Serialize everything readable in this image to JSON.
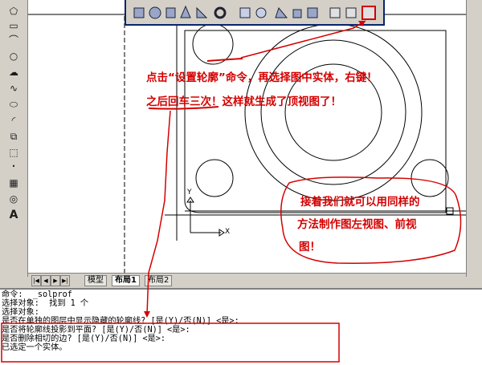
{
  "toolbar_icons": [
    "box-icon",
    "sphere-icon",
    "cylinder-icon",
    "cone-icon",
    "wedge-icon",
    "torus-icon",
    "extrude-icon",
    "revolve-icon",
    "slice-icon",
    "section-icon",
    "interfere-icon",
    "setup-drawing-icon",
    "setup-view-icon",
    "setup-profile-icon"
  ],
  "left_tools": [
    "polygon-icon",
    "rectangle-icon",
    "arc-icon",
    "circle-icon",
    "revision-cloud-icon",
    "spline-icon",
    "ellipse-icon",
    "ellipse-arc-icon",
    "insert-block-icon",
    "make-block-icon",
    "point-icon",
    "hatch-icon",
    "region-icon",
    "text-icon"
  ],
  "glyphs": {
    "polygon": "⬠",
    "rectangle": "▭",
    "arc": "⌒",
    "circle": "○",
    "cloud": "☁",
    "spline": "∿",
    "ellipse": "⬭",
    "ellarc": "◜",
    "insert": "⧉",
    "block": "⬚",
    "point": "·",
    "hatch": "▦",
    "region": "◎",
    "text": "A"
  },
  "tabs": {
    "model": "模型",
    "layout1": "布局1",
    "layout2": "布局2"
  },
  "annotations": {
    "line1": "点击“设置轮廓”命令，再选择图中实体，右键！",
    "line2": "之后回车三次！这样就生成了顶视图了！",
    "box_line1": "接着我们就可以用同样的",
    "box_line2": "方法制作图左视图、前视",
    "box_line3": "图！"
  },
  "axis": {
    "y": "Y",
    "x": "X"
  },
  "command_lines": [
    "命令:  _solprof",
    "选择对象:  找到 1 个",
    "选择对象:",
    "是否在单独的图层中显示隐藏的轮廓线? [是(Y)/否(N)] <是>:",
    "是否将轮廓线投影到平面? [是(Y)/否(N)] <是>:",
    "是否删除相切的边? [是(Y)/否(N)] <是>:",
    "已选定一个实体。"
  ],
  "colors": {
    "annotation": "#d40000",
    "toolbar_border": "#0a246a",
    "window_bg": "#d4d0c8"
  }
}
